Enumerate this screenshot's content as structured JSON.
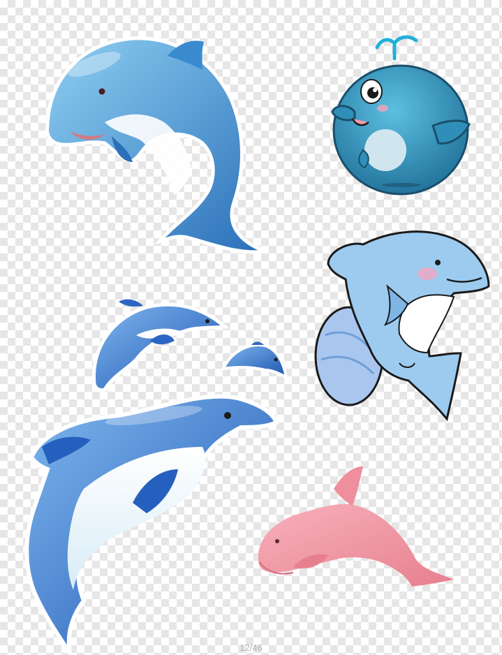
{
  "page_counter": "12/46",
  "colors": {
    "checker_light": "#ffffff",
    "checker_dark": "#e6e6e6",
    "dolphin_blue_light": "#7cc0ea",
    "dolphin_blue_dark": "#2f78c4",
    "whale_teal": "#2f8fb8",
    "cartoon_dolphin_body": "#8ec4ec",
    "pink_dolphin": "#f29aa6"
  },
  "illustrations": [
    {
      "name": "glossy-blue-dolphin",
      "icon": "dolphin-icon"
    },
    {
      "name": "cartoon-baby-whale",
      "icon": "whale-icon"
    },
    {
      "name": "cartoon-smiling-dolphin",
      "icon": "dolphin-icon"
    },
    {
      "name": "pair-of-small-blue-dolphins",
      "icon": "dolphin-icon"
    },
    {
      "name": "large-blue-leaping-dolphin",
      "icon": "dolphin-icon"
    },
    {
      "name": "pink-dolphin",
      "icon": "dolphin-icon"
    }
  ]
}
